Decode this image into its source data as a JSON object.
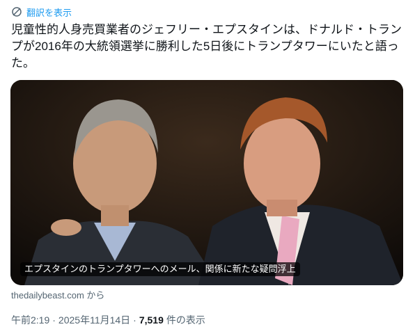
{
  "translate": {
    "label": "翻訳を表示",
    "icon": "translate-icon"
  },
  "tweet": {
    "text": "児童性的人身売買業者のジェフリー・エプスタインは、ドナルド・トランプが2016年の大統領選挙に勝利した5日後にトランプタワーにいたと語った。"
  },
  "link_card": {
    "headline": "エプスタインのトランプタワーへのメール、関係に新たな疑問浮上",
    "source": "thedailybeast.com から"
  },
  "meta": {
    "time": "午前2:19",
    "separator": "·",
    "date": "2025年11月14日",
    "separator2": "·",
    "views_count": "7,519",
    "views_label": "件の表示"
  },
  "colors": {
    "accent": "#1d9bf0",
    "secondary_text": "#536471",
    "text": "#0f1419"
  }
}
